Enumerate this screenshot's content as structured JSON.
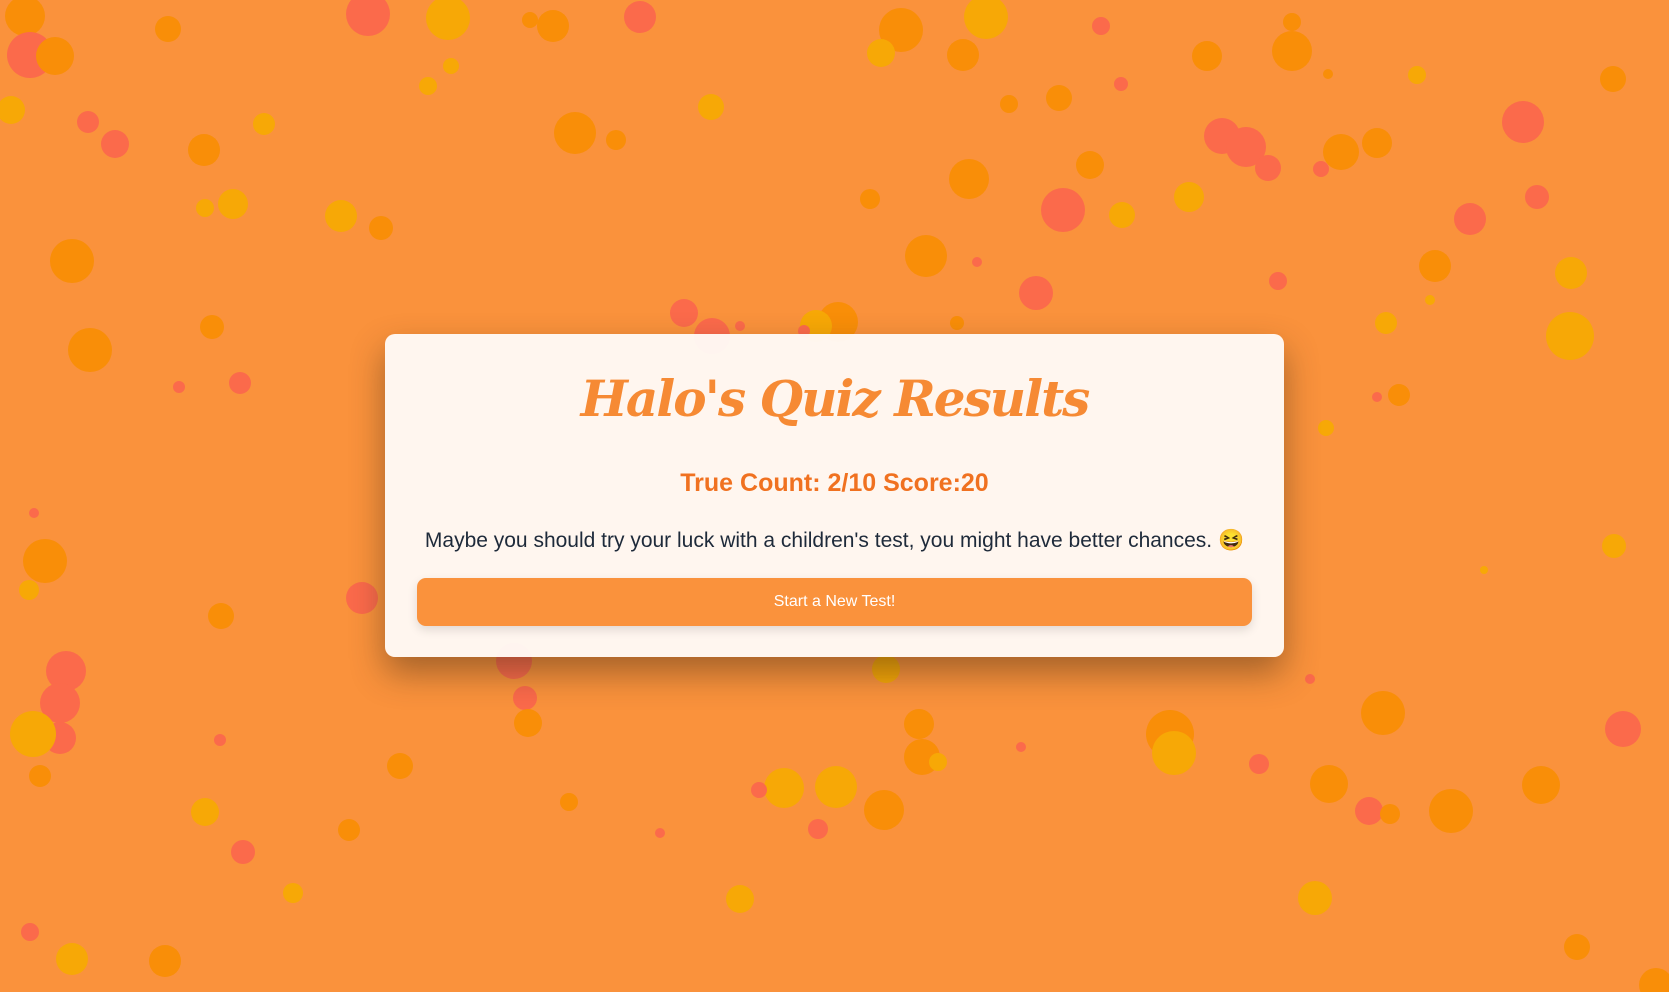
{
  "background_color": "#fa923c",
  "confetti_colors": {
    "red": "#fb6a4b",
    "dark_orange": "#f98e08",
    "yellow": "#f7a806"
  },
  "card": {
    "title": "Halo's Quiz Results",
    "score_line": "True Count: 2/10 Score:20",
    "message": "Maybe you should try your luck with a children's test, you might have better chances. 😆",
    "button_label": "Start a New Test!"
  }
}
